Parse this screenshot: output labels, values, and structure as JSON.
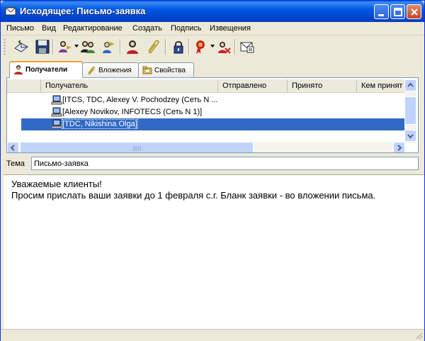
{
  "window": {
    "title": "Исходящее: Письмо-заявка"
  },
  "menu": [
    "Письмо",
    "Вид",
    "Редактирование",
    "Создать",
    "Подпись",
    "Извещения"
  ],
  "toolbar": {
    "icons": [
      "send-icon",
      "save-icon",
      "recipients-icon",
      "address-book-icon",
      "group-icon",
      "contact-icon",
      "attach-icon",
      "encrypt-icon",
      "sign-icon",
      "certificate-icon",
      "notify-icon"
    ]
  },
  "tabs": [
    {
      "label": "Получатели",
      "icon": "person-icon",
      "active": true
    },
    {
      "label": "Вложения",
      "icon": "paperclip-icon",
      "active": false
    },
    {
      "label": "Свойства",
      "icon": "folder-icon",
      "active": false
    }
  ],
  "recipients": {
    "columns": [
      "Получатель",
      "Отправлено",
      "Принято",
      "Кем принят"
    ],
    "rows": [
      {
        "name": "[ITCS, TDC, Alexey V. Pochodzey (Сеть N ...",
        "selected": false
      },
      {
        "name": "[Alexey Novikov, INFOTECS (Сеть N 1)]",
        "selected": false
      },
      {
        "name": "[TDC, Nikishina Olga]",
        "selected": true
      }
    ]
  },
  "subject": {
    "label": "Тема",
    "value": "Письмо-заявка"
  },
  "body": {
    "lines": [
      "Уважаемые клиенты!",
      "Просим прислать ваши заявки до 1 февраля с.г. Бланк заявки - во вложении письма."
    ]
  },
  "colors": {
    "titlebar": "#0058e6",
    "selection": "#316ac5",
    "window_bg": "#ece9d8"
  }
}
